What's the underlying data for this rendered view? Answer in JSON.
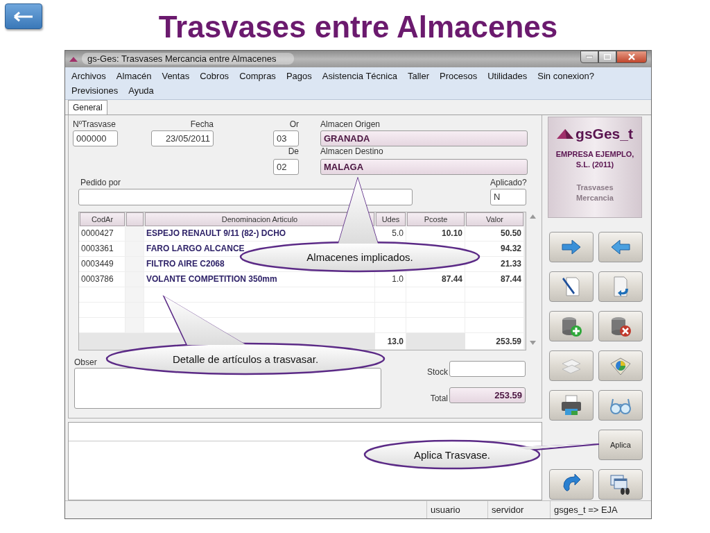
{
  "slide": {
    "title": "Trasvases entre Almacenes"
  },
  "window": {
    "title": "gs-Ges: Trasvases Mercancia entre Almacenes"
  },
  "menu_rows": [
    [
      "Archivos",
      "Almacén",
      "Ventas",
      "Cobros",
      "Compras",
      "Pagos",
      "Asistencia Técnica",
      "Taller",
      "Procesos",
      "Utilidades",
      "Sin conexion?"
    ],
    [
      "Previsiones",
      "Ayuda"
    ]
  ],
  "tabs": [
    {
      "label": "General",
      "selected": true
    }
  ],
  "form": {
    "number": {
      "label": "NºTrasvase",
      "value": "000000"
    },
    "date": {
      "label": "Fecha",
      "value": "23/05/2011"
    },
    "origin_code": {
      "label": "Or",
      "value": "03"
    },
    "origin": {
      "label": "Almacen Origen",
      "value": "GRANADA"
    },
    "destination_code": {
      "label": "De",
      "value": "02"
    },
    "destination": {
      "label": "Almacen Destino",
      "value": "MALAGA"
    },
    "requested_by": {
      "label": "Pedido por"
    },
    "applied": {
      "label": "Aplicado?",
      "value": "N"
    }
  },
  "table": {
    "columns": [
      "CodAr",
      "Denominacion Articulo",
      "Udes",
      "Pcoste",
      "Valor"
    ],
    "rows": [
      {
        "code": "0000427",
        "name": "ESPEJO RENAULT 9/11 (82-) DCHO",
        "units": "5.0",
        "cost": "10.10",
        "value": "50.50"
      },
      {
        "code": "0003361",
        "name": "FARO LARGO ALCANCE",
        "value": "94.32"
      },
      {
        "code": "0003449",
        "name": "FILTRO AIRE C2068",
        "value": "21.33"
      },
      {
        "code": "0003786",
        "name": "VOLANTE COMPETITION 350mm",
        "units": "1.0",
        "cost": "87.44",
        "value": "87.44"
      }
    ],
    "totals": {
      "units": "13.0",
      "value": "253.59"
    }
  },
  "notes": {
    "label": "Obser"
  },
  "stock": {
    "label": "Stock"
  },
  "total": {
    "label": "Total",
    "value": "253.59"
  },
  "logo": {
    "name": "gsGes_t",
    "company": [
      "EMPRESA EJEMPLO,",
      "S.L. (2011)"
    ],
    "module": [
      "Trasvases",
      "Mercancia"
    ]
  },
  "tool_buttons": [
    {
      "kind": "icon"
    },
    {
      "kind": "icon"
    },
    {
      "kind": "icon"
    },
    {
      "kind": "icon"
    },
    {
      "kind": "icon"
    },
    {
      "kind": "icon"
    },
    {
      "kind": "icon"
    },
    {
      "kind": "icon"
    },
    {
      "kind": "icon"
    },
    {
      "kind": "icon"
    },
    {
      "kind": "blank"
    },
    {
      "kind": "text",
      "label": "Aplica"
    },
    {
      "kind": "icon"
    },
    {
      "kind": "icon"
    }
  ],
  "status_bar": [
    "usuario",
    "servidor",
    "gsges_t => EJA"
  ],
  "callouts": [
    {
      "text": "Almacenes implicados."
    },
    {
      "text": "Detalle de artículos a trasvasar."
    },
    {
      "text": "Aplica Trasvase."
    }
  ]
}
